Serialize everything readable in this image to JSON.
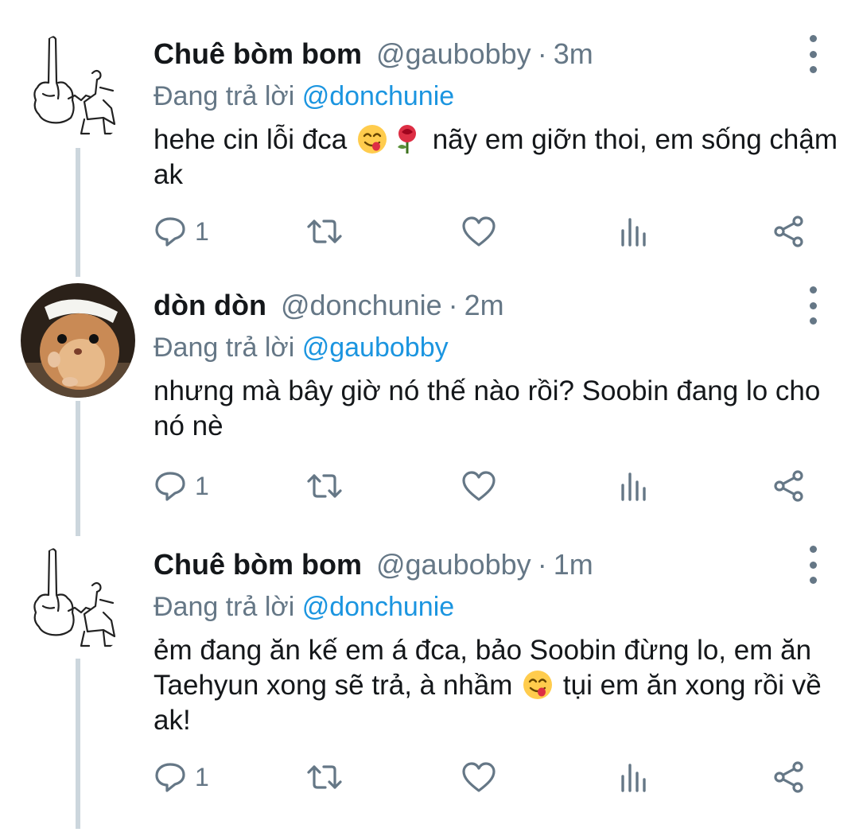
{
  "tweets": [
    {
      "name": "Chuê bòm bom",
      "handle": "@gaubobby",
      "separator": "·",
      "time": "3m",
      "reply_prefix": "Đang trả lời",
      "reply_to": "@donchunie",
      "text_before": "hehe cin lỗi đca",
      "text_after": "nãy em giỡn thoi, em sống chậm ak",
      "reply_count": "1"
    },
    {
      "name": "dòn dòn",
      "handle": "@donchunie",
      "separator": "·",
      "time": "2m",
      "reply_prefix": "Đang trả lời",
      "reply_to": "@gaubobby",
      "text": "nhưng mà bây giờ nó thế nào rồi? Soobin đang lo cho nó nè",
      "reply_count": "1"
    },
    {
      "name": "Chuê bòm bom",
      "handle": "@gaubobby",
      "separator": "·",
      "time": "1m",
      "reply_prefix": "Đang trả lời",
      "reply_to": "@donchunie",
      "text_before": "ẻm đang ăn kế em á đca, bảo Soobin đừng lo, em ăn Taehyun xong sẽ trả, à nhầm",
      "text_after": "tụi em ăn xong rồi về ak!",
      "reply_count": "1"
    }
  ],
  "icons": {
    "reply": "reply-icon",
    "retweet": "retweet-icon",
    "like": "heart-icon",
    "analytics": "analytics-icon",
    "share": "share-icon",
    "more": "more-vertical-icon",
    "emoji_yum": "face-savoring-food-emoji",
    "emoji_rose": "rose-emoji"
  },
  "colors": {
    "text": "#14171a",
    "secondary": "#657786",
    "link": "#1b95e0",
    "thread_line": "#ccd6dd"
  }
}
